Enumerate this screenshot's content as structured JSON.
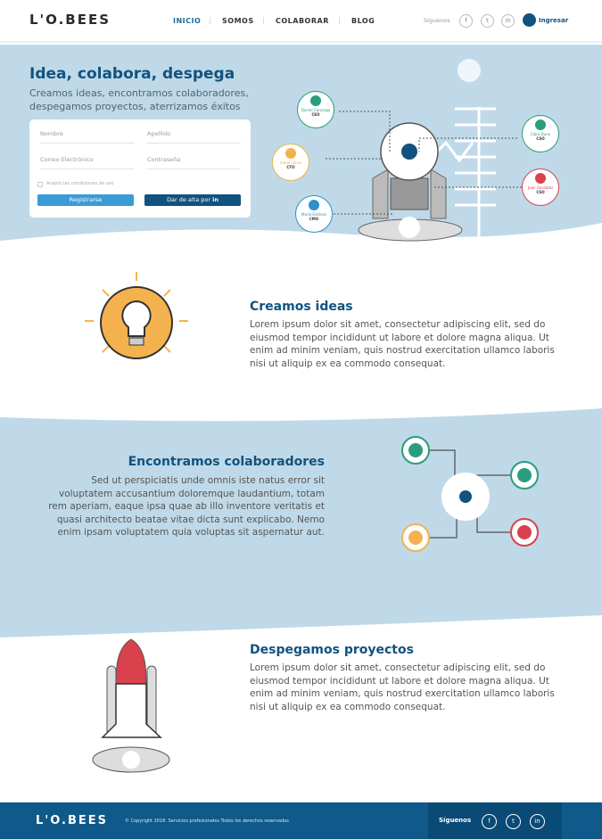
{
  "brand": {
    "logo": "L'O.BEES"
  },
  "nav": {
    "items": [
      "INICIO",
      "SOMOS",
      "COLABORAR",
      "BLOG"
    ],
    "active": "INICIO"
  },
  "header": {
    "follow_label": "Síguenos",
    "social": [
      "f",
      "t",
      "in"
    ],
    "login_label": "Ingresar"
  },
  "hero": {
    "title": "Idea, colabora, despega",
    "subtitle_1": "Creamos ideas, encontramos colaboradores,",
    "subtitle_2": "despegamos proyectos, aterrizamos éxitos",
    "form": {
      "first_name": "Nombre",
      "last_name": "Apellido",
      "email": "Correo Electrónico",
      "password": "Contraseña",
      "terms": "Acepto las condiciones de uso",
      "register": "Registrarse",
      "linkedin": "Dar de alta por",
      "linkedin_logo": "in"
    },
    "team": [
      {
        "name": "Daniel Carvargo",
        "role": "CEO",
        "color": "#2a9d7c"
      },
      {
        "name": "Isabel López",
        "role": "CTO",
        "color": "#f0b54a"
      },
      {
        "name": "María Estévez",
        "role": "CMO",
        "color": "#2d8fce"
      },
      {
        "name": "Clara Duno",
        "role": "CSO",
        "color": "#2a9d7c"
      },
      {
        "name": "Juan González",
        "role": "CSO",
        "color": "#d9414d"
      }
    ]
  },
  "sections": [
    {
      "title": "Creamos ideas",
      "text": "Lorem ipsum dolor sit amet, consectetur adipiscing elit, sed do eiusmod tempor incididunt ut labore et dolore magna aliqua. Ut enim ad minim veniam, quis nostrud exercitation ullamco laboris nisi ut aliquip ex ea commodo consequat."
    },
    {
      "title": "Encontramos colaboradores",
      "text": "Sed ut perspiciatis unde omnis iste natus error sit voluptatem accusantium doloremque laudantium, totam rem aperiam, eaque ipsa quae ab illo inventore veritatis et quasi architecto beatae vitae dicta sunt explicabo. Nemo enim ipsam voluptatem quia voluptas sit aspernatur aut."
    },
    {
      "title": "Despegamos proyectos",
      "text": "Lorem ipsum dolor sit amet, consectetur adipiscing elit, sed do eiusmod tempor incididunt ut labore et dolore magna aliqua. Ut enim ad minim veniam, quis nostrud exercitation ullamco laboris nisi ut aliquip ex ea commodo consequat."
    }
  ],
  "footer": {
    "logo": "L'O.BEES",
    "copyright": "© Copyright 2018. Servicios profesionales Todos los derechos reservados",
    "follow_label": "Síguenos",
    "social": [
      "f",
      "t",
      "in"
    ]
  },
  "colors": {
    "primary": "#12527f",
    "hero_bg": "#bfd9e8",
    "footer": "#0f5a8a",
    "accent": "#3a9bd5",
    "idea": "#f4b24f"
  }
}
